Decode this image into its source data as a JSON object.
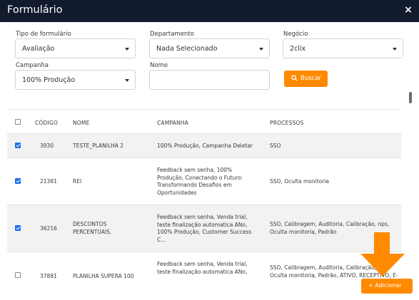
{
  "window": {
    "title": "Formulário",
    "close_icon": "×"
  },
  "filters": {
    "tipo": {
      "label": "Tipo de formulário",
      "value": "Avaliação"
    },
    "departamento": {
      "label": "Departamento",
      "value": "Nada Selecionado"
    },
    "negocio": {
      "label": "Negócio",
      "value": "2clix"
    },
    "campanha": {
      "label": "Campanha",
      "value": "100% Produção"
    },
    "nome": {
      "label": "Nome",
      "value": ""
    },
    "buscar_label": "Buscar"
  },
  "table": {
    "headers": {
      "codigo": "CÓDIGO",
      "nome": "NOME",
      "campanha": "CAMPANHA",
      "processos": "PROCESSOS"
    },
    "rows": [
      {
        "checked": true,
        "codigo": "3930",
        "nome": "TESTE_PLANILHA 2",
        "campanha": "100% Produção, Campanha Deletar",
        "processos": "SSO"
      },
      {
        "checked": true,
        "codigo": "21381",
        "nome": "REI",
        "campanha_lines": [
          "Feedback sem senha, 100%",
          "Produção, Conectando o Futuro:",
          "Transformando Desafios em",
          "Oportunidades"
        ],
        "processos": "SSO, Oculta monitoria"
      },
      {
        "checked": true,
        "codigo": "36216",
        "nome_lines": [
          "DESCONTOS",
          "PERCENTUAIS."
        ],
        "campanha_lines": [
          "Feedback sem senha, Venda trial,",
          "teste finalização automatica ANo,",
          "100% Produção, Customer Success",
          "C..."
        ],
        "processos_lines": [
          "SSO, Calibragem, Auditoria, Calibração, nps,",
          "Oculta monitoria, Padrão"
        ]
      },
      {
        "checked": false,
        "codigo": "37881",
        "nome": "PLANILHA SUPERA 100",
        "campanha_lines": [
          "Feedback sem senha, Venda trial,",
          "teste finalização automatica ANo,"
        ],
        "processos_lines": [
          "SSO, Calibragem, Auditoria, Calibração, nps,",
          "Oculta monitoria, Padrão, ATIVO, RECEPTIVO, E-"
        ]
      }
    ]
  },
  "add_button_label": "+ Adicionar",
  "colors": {
    "accent": "#ff8a00",
    "titlebar": "#121b2d",
    "checkbox": "#1a73e8"
  }
}
